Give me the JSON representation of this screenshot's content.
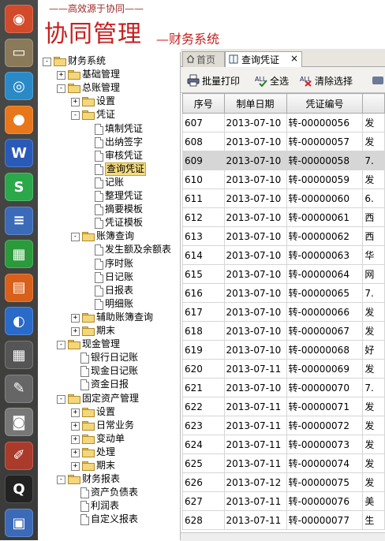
{
  "header": {
    "slogan": "——高效源于协同——",
    "title": "协同管理",
    "subtitle": "—财务系统"
  },
  "launcher": {
    "icons": [
      "ubuntu-icon",
      "files-icon",
      "chromium-icon",
      "firefox-icon",
      "writer-icon",
      "sheet-icon",
      "document-icon",
      "calc-icon",
      "impress-icon",
      "thunderbird-icon",
      "calculator-icon",
      "text-editor-icon",
      "camera-icon",
      "paint-icon",
      "qq-icon",
      "display-icon"
    ]
  },
  "tree": [
    {
      "label": "财务系统",
      "depth": 0,
      "kind": "folder",
      "exp": "-"
    },
    {
      "label": "基础管理",
      "depth": 1,
      "kind": "folder",
      "exp": "+"
    },
    {
      "label": "总账管理",
      "depth": 1,
      "kind": "folder",
      "exp": "-"
    },
    {
      "label": "设置",
      "depth": 2,
      "kind": "folder",
      "exp": "+"
    },
    {
      "label": "凭证",
      "depth": 2,
      "kind": "folder",
      "exp": "-"
    },
    {
      "label": "填制凭证",
      "depth": 3,
      "kind": "doc"
    },
    {
      "label": "出纳签字",
      "depth": 3,
      "kind": "doc"
    },
    {
      "label": "审核凭证",
      "depth": 3,
      "kind": "doc"
    },
    {
      "label": "查询凭证",
      "depth": 3,
      "kind": "doc",
      "selected": true
    },
    {
      "label": "记账",
      "depth": 3,
      "kind": "doc"
    },
    {
      "label": "整理凭证",
      "depth": 3,
      "kind": "doc"
    },
    {
      "label": "摘要模板",
      "depth": 3,
      "kind": "doc"
    },
    {
      "label": "凭证模板",
      "depth": 3,
      "kind": "doc"
    },
    {
      "label": "账簿查询",
      "depth": 2,
      "kind": "folder",
      "exp": "-"
    },
    {
      "label": "发生额及余额表",
      "depth": 3,
      "kind": "doc"
    },
    {
      "label": "序时账",
      "depth": 3,
      "kind": "doc"
    },
    {
      "label": "日记账",
      "depth": 3,
      "kind": "doc"
    },
    {
      "label": "日报表",
      "depth": 3,
      "kind": "doc"
    },
    {
      "label": "明细账",
      "depth": 3,
      "kind": "doc"
    },
    {
      "label": "辅助账簿查询",
      "depth": 2,
      "kind": "folder",
      "exp": "+"
    },
    {
      "label": "期末",
      "depth": 2,
      "kind": "folder",
      "exp": "+"
    },
    {
      "label": "现金管理",
      "depth": 1,
      "kind": "folder",
      "exp": "-"
    },
    {
      "label": "银行日记账",
      "depth": 2,
      "kind": "doc"
    },
    {
      "label": "现金日记账",
      "depth": 2,
      "kind": "doc"
    },
    {
      "label": "资金日报",
      "depth": 2,
      "kind": "doc"
    },
    {
      "label": "固定资产管理",
      "depth": 1,
      "kind": "folder",
      "exp": "-"
    },
    {
      "label": "设置",
      "depth": 2,
      "kind": "folder",
      "exp": "+"
    },
    {
      "label": "日常业务",
      "depth": 2,
      "kind": "folder",
      "exp": "+"
    },
    {
      "label": "变动单",
      "depth": 2,
      "kind": "folder",
      "exp": "+"
    },
    {
      "label": "处理",
      "depth": 2,
      "kind": "folder",
      "exp": "+"
    },
    {
      "label": "期末",
      "depth": 2,
      "kind": "folder",
      "exp": "+"
    },
    {
      "label": "财务报表",
      "depth": 1,
      "kind": "folder",
      "exp": "-"
    },
    {
      "label": "资产负债表",
      "depth": 2,
      "kind": "doc"
    },
    {
      "label": "利润表",
      "depth": 2,
      "kind": "doc"
    },
    {
      "label": "自定义报表",
      "depth": 2,
      "kind": "doc"
    }
  ],
  "tabs": {
    "home": "首页",
    "query": "查询凭证",
    "close": "×"
  },
  "toolbar": {
    "batch_print": "批量打印",
    "select_all": "全选",
    "clear_select": "清除选择"
  },
  "grid": {
    "columns": [
      "序号",
      "制单日期",
      "凭证编号",
      ""
    ],
    "rows": [
      [
        "607",
        "2013-07-10",
        "转-00000056",
        "发"
      ],
      [
        "608",
        "2013-07-10",
        "转-00000057",
        "发"
      ],
      [
        "609",
        "2013-07-10",
        "转-00000058",
        "7."
      ],
      [
        "610",
        "2013-07-10",
        "转-00000059",
        "发"
      ],
      [
        "611",
        "2013-07-10",
        "转-00000060",
        "6."
      ],
      [
        "612",
        "2013-07-10",
        "转-00000061",
        "西"
      ],
      [
        "613",
        "2013-07-10",
        "转-00000062",
        "西"
      ],
      [
        "614",
        "2013-07-10",
        "转-00000063",
        "华"
      ],
      [
        "615",
        "2013-07-10",
        "转-00000064",
        "网"
      ],
      [
        "616",
        "2013-07-10",
        "转-00000065",
        "7."
      ],
      [
        "617",
        "2013-07-10",
        "转-00000066",
        "发"
      ],
      [
        "618",
        "2013-07-10",
        "转-00000067",
        "发"
      ],
      [
        "619",
        "2013-07-10",
        "转-00000068",
        "好"
      ],
      [
        "620",
        "2013-07-11",
        "转-00000069",
        "发"
      ],
      [
        "621",
        "2013-07-10",
        "转-00000070",
        "7."
      ],
      [
        "622",
        "2013-07-11",
        "转-00000071",
        "发"
      ],
      [
        "623",
        "2013-07-11",
        "转-00000072",
        "发"
      ],
      [
        "624",
        "2013-07-11",
        "转-00000073",
        "发"
      ],
      [
        "625",
        "2013-07-11",
        "转-00000074",
        "发"
      ],
      [
        "626",
        "2013-07-12",
        "转-00000075",
        "发"
      ],
      [
        "627",
        "2013-07-11",
        "转-00000076",
        "美"
      ],
      [
        "628",
        "2013-07-11",
        "转-00000077",
        "生"
      ]
    ],
    "highlighted_row": 2
  }
}
